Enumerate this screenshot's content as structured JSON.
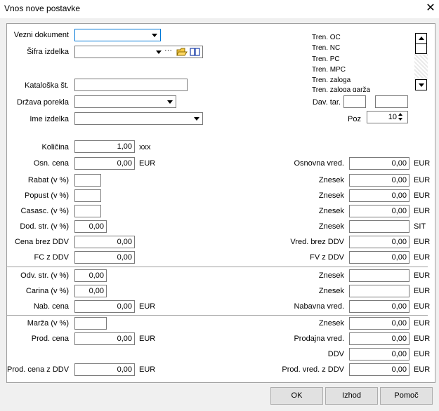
{
  "window": {
    "title": "Vnos nove postavke",
    "close_glyph": "✕"
  },
  "header": {
    "vezni_dokument_label": "Vezni dokument",
    "sifra_izdelka_label": "Šifra izdelka",
    "kataloska_label": "Kataloška št.",
    "drzava_label": "Država porekla",
    "ime_label": "Ime izdelka",
    "dav_tar_label": "Dav. tar.",
    "poz_label": "Poz",
    "poz_value": "10",
    "ellipsis_glyph": "···"
  },
  "tren_list": [
    "Tren. OC",
    "Tren. NC",
    "Tren. PC",
    "Tren. MPC",
    "Tren. zaloga",
    "Tren. zaloga garža"
  ],
  "left": {
    "kolicina_label": "Količina",
    "kolicina_value": "1,00",
    "kolicina_unit": "xxx",
    "osn_cena_label": "Osn. cena",
    "osn_cena_value": "0,00",
    "osn_cena_unit": "EUR",
    "rabat_label": "Rabat (v %)",
    "popust_label": "Popust (v %)",
    "casasc_label": "Casasc. (v %)",
    "dod_str_label": "Dod. str. (v %)",
    "dod_str_value": "0,00",
    "cena_brez_label": "Cena brez DDV",
    "cena_brez_value": "0,00",
    "fc_label": "FC z DDV",
    "fc_value": "0,00",
    "odv_label": "Odv. str. (v %)",
    "odv_value": "0,00",
    "carina_label": "Carina (v %)",
    "carina_value": "0,00",
    "nab_label": "Nab. cena",
    "nab_value": "0,00",
    "nab_unit": "EUR",
    "marza_label": "Marža (v %)",
    "prod_label": "Prod. cena",
    "prod_value": "0,00",
    "prod_unit": "EUR",
    "prod_ddv_label": "Prod. cena z DDV",
    "prod_ddv_value": "0,00",
    "prod_ddv_unit": "EUR"
  },
  "right": {
    "rows": [
      {
        "label": "Osnovna vred.",
        "value": "0,00",
        "unit": "EUR"
      },
      {
        "label": "Znesek",
        "value": "0,00",
        "unit": "EUR"
      },
      {
        "label": "Znesek",
        "value": "0,00",
        "unit": "EUR"
      },
      {
        "label": "Znesek",
        "value": "0,00",
        "unit": "EUR"
      },
      {
        "label": "Znesek",
        "value": "",
        "unit": "SIT"
      },
      {
        "label": "Vred. brez DDV",
        "value": "0,00",
        "unit": "EUR"
      },
      {
        "label": "FV z DDV",
        "value": "0,00",
        "unit": "EUR"
      },
      {
        "label": "Znesek",
        "value": "",
        "unit": "EUR"
      },
      {
        "label": "Znesek",
        "value": "",
        "unit": "EUR"
      },
      {
        "label": "Nabavna vred.",
        "value": "0,00",
        "unit": "EUR"
      },
      {
        "label": "Znesek",
        "value": "0,00",
        "unit": "EUR"
      },
      {
        "label": "Prodajna vred.",
        "value": "0,00",
        "unit": "EUR"
      },
      {
        "label": "DDV",
        "value": "0,00",
        "unit": "EUR"
      },
      {
        "label": "Prod. vred. z DDV",
        "value": "0,00",
        "unit": "EUR"
      }
    ]
  },
  "buttons": {
    "ok": "OK",
    "izhod": "Izhod",
    "pomoc": "Pomoč"
  }
}
